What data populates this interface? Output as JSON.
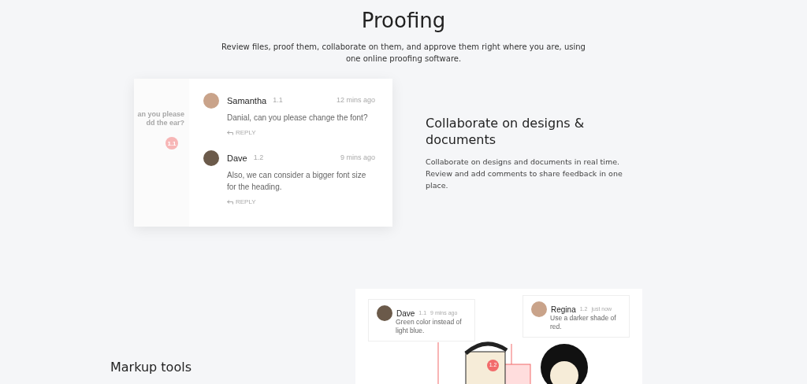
{
  "header": {
    "title": "Proofing",
    "subtitle": "Review files, proof them, collaborate on them, and approve them right where you are, using one online proofing software."
  },
  "collaborate": {
    "preview": {
      "fragment_lines": [
        "an you please",
        "dd the ear?"
      ],
      "badge": "1.1"
    },
    "comments": [
      {
        "name": "Samantha",
        "ref": "1.1",
        "time": "12 mins ago",
        "text": "Danial, can you please change the font?",
        "action": "REPLY"
      },
      {
        "name": "Dave",
        "ref": "1.2",
        "time": "9 mins ago",
        "text": "Also, we can consider a bigger font size for the heading.",
        "action": "REPLY"
      }
    ],
    "heading": "Collaborate on designs & documents",
    "body": "Collaborate on designs and documents in real time. Review and add comments to share feedback in one place."
  },
  "markup": {
    "heading": "Markup tools",
    "comments": [
      {
        "name": "Dave",
        "ref": "1.1",
        "time": "9 mins ago",
        "text": "Green color instead of light blue."
      },
      {
        "name": "Regina",
        "ref": "1.2",
        "time": "just now",
        "text": "Use a darker shade of red."
      }
    ],
    "badge": "1.2"
  }
}
